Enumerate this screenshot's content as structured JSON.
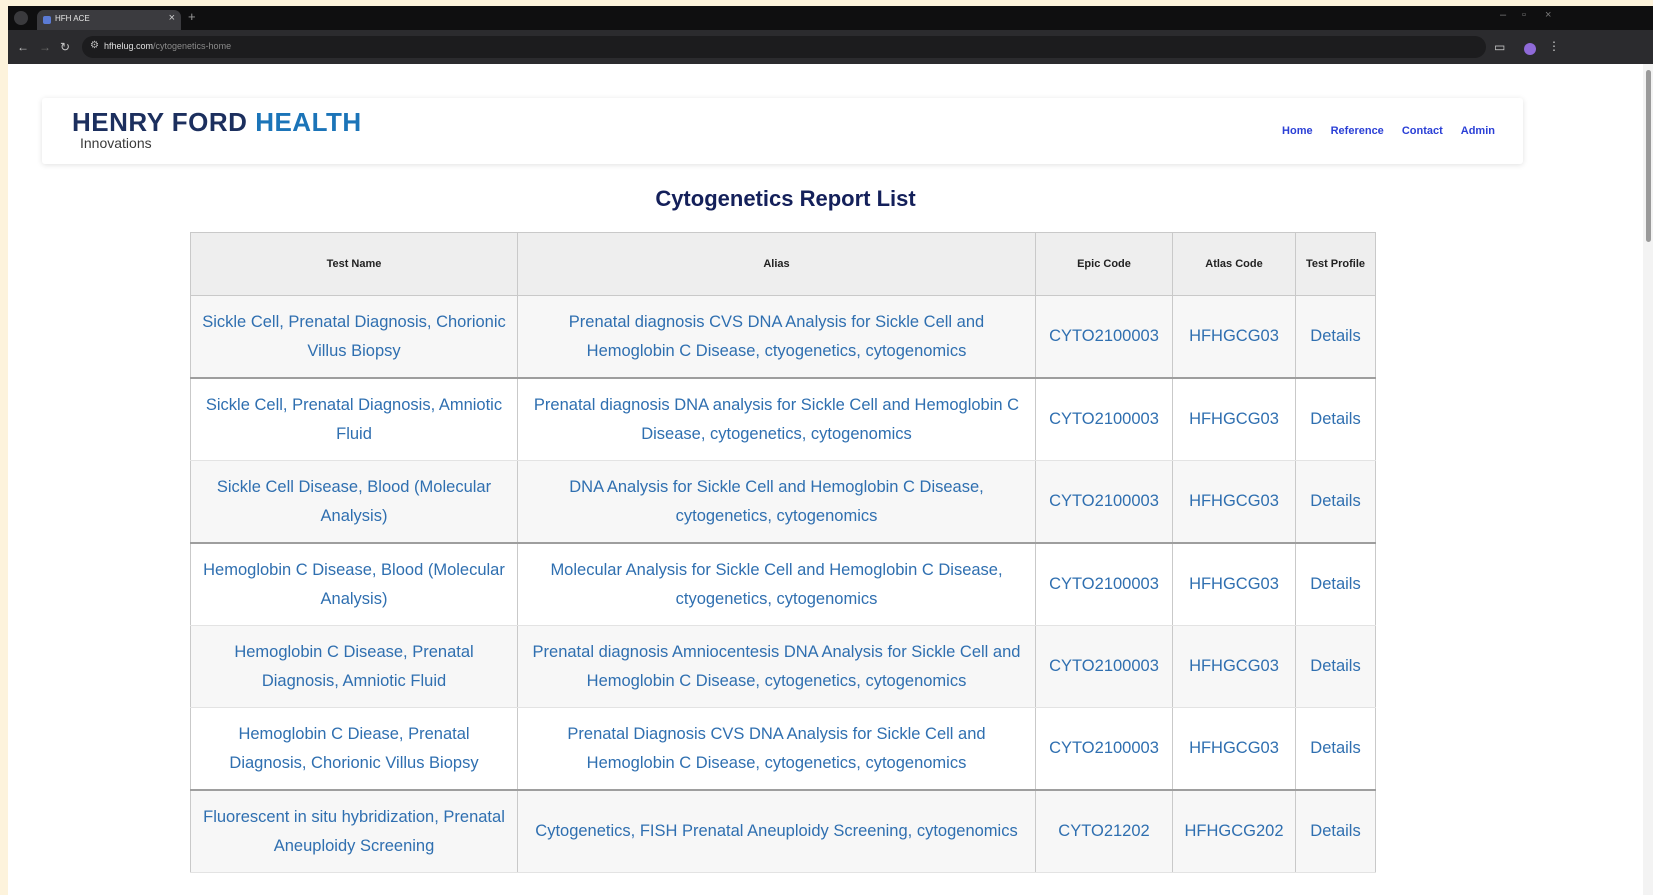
{
  "browser": {
    "tab_title": "HFH ACE",
    "tab_close": "×",
    "new_tab": "+",
    "url_domain": "hfhelug.com",
    "url_path": "/cytogenetics-home",
    "window_min": "–",
    "window_max": "▫",
    "window_close": "×"
  },
  "header": {
    "logo_part1": "HENRY FORD ",
    "logo_part2": "HEALTH",
    "logo_sub": "Innovations",
    "nav": [
      "Home",
      "Reference",
      "Contact",
      "Admin"
    ]
  },
  "page": {
    "title": "Cytogenetics Report List"
  },
  "table": {
    "headers": [
      "Test Name",
      "Alias",
      "Epic Code",
      "Atlas Code",
      "Test Profile"
    ],
    "rows": [
      {
        "test_name": "Sickle Cell, Prenatal Diagnosis, Chorionic Villus Biopsy",
        "alias": "Prenatal diagnosis CVS DNA Analysis for Sickle Cell and Hemoglobin C Disease, ctyogenetics, cytogenomics",
        "epic": "CYTO2100003",
        "atlas": "HFHGCG03",
        "profile": "Details"
      },
      {
        "test_name": "Sickle Cell, Prenatal Diagnosis, Amniotic Fluid",
        "alias": "Prenatal diagnosis DNA analysis for Sickle Cell and Hemoglobin C Disease, cytogenetics, cytogenomics",
        "epic": "CYTO2100003",
        "atlas": "HFHGCG03",
        "profile": "Details"
      },
      {
        "test_name": "Sickle Cell Disease, Blood (Molecular Analysis)",
        "alias": "DNA Analysis for Sickle Cell and Hemoglobin C Disease, cytogenetics, cytogenomics",
        "epic": "CYTO2100003",
        "atlas": "HFHGCG03",
        "profile": "Details"
      },
      {
        "test_name": "Hemoglobin C Disease, Blood (Molecular Analysis)",
        "alias": "Molecular Analysis for Sickle Cell and Hemoglobin C Disease, ctyogenetics, cytogenomics",
        "epic": "CYTO2100003",
        "atlas": "HFHGCG03",
        "profile": "Details"
      },
      {
        "test_name": "Hemoglobin C Disease, Prenatal Diagnosis, Amniotic Fluid",
        "alias": "Prenatal diagnosis Amniocentesis DNA Analysis for Sickle Cell and Hemoglobin C Disease, cytogenetics, cytogenomics",
        "epic": "CYTO2100003",
        "atlas": "HFHGCG03",
        "profile": "Details"
      },
      {
        "test_name": "Hemoglobin C Diease, Prenatal Diagnosis, Chorionic Villus Biopsy",
        "alias": "Prenatal Diagnosis CVS DNA Analysis for Sickle Cell and Hemoglobin C Disease, cytogenetics, cytogenomics",
        "epic": "CYTO2100003",
        "atlas": "HFHGCG03",
        "profile": "Details"
      },
      {
        "test_name": "Fluorescent in situ hybridization, Prenatal Aneuploidy Screening",
        "alias": "Cytogenetics, FISH Prenatal Aneuploidy Screening, cytogenomics",
        "epic": "CYTO21202",
        "atlas": "HFHGCG202",
        "profile": "Details"
      }
    ]
  }
}
